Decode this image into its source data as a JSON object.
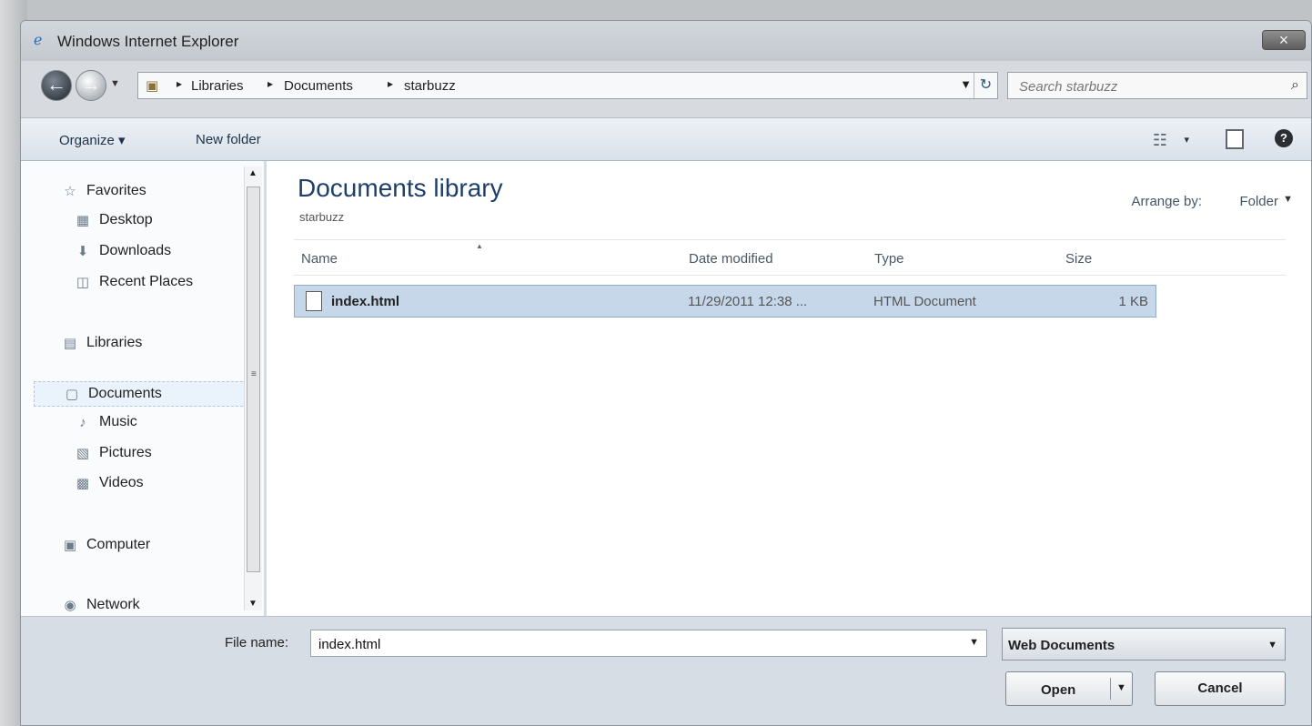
{
  "window": {
    "title": "Windows Internet Explorer",
    "close_symbol": "×"
  },
  "nav": {
    "back_icon": "back-arrow-icon",
    "forward_icon": "forward-arrow-icon",
    "recent_dropdown": "▼"
  },
  "address": {
    "breadcrumbs": [
      "Libraries",
      "Documents",
      "starbuzz"
    ],
    "separator": "▸",
    "dropdown_symbol": "▼",
    "refresh_symbol": "↻"
  },
  "search": {
    "placeholder": "Search starbuzz",
    "value": ""
  },
  "toolbar": {
    "organize_label": "Organize ▾",
    "new_folder_label": "New folder",
    "view_dropdown": "▾"
  },
  "sidebar": {
    "items": [
      {
        "label": "Favorites",
        "icon": "star-icon"
      },
      {
        "label": "Desktop",
        "icon": "desktop-icon"
      },
      {
        "label": "Downloads",
        "icon": "downloads-icon"
      },
      {
        "label": "Recent Places",
        "icon": "recent-places-icon"
      },
      {
        "label": "Libraries",
        "icon": "libraries-icon"
      },
      {
        "label": "Documents",
        "icon": "documents-icon",
        "selected": true
      },
      {
        "label": "Music",
        "icon": "music-icon"
      },
      {
        "label": "Pictures",
        "icon": "pictures-icon"
      },
      {
        "label": "Videos",
        "icon": "videos-icon"
      },
      {
        "label": "Computer",
        "icon": "computer-icon"
      },
      {
        "label": "Network",
        "icon": "network-icon"
      }
    ]
  },
  "main": {
    "library_title": "Documents library",
    "library_sub": "starbuzz",
    "arrange_label": "Arrange by:",
    "arrange_value": "Folder",
    "arrange_symbol": "▼",
    "columns": [
      "Name",
      "Date modified",
      "Type",
      "Size"
    ],
    "sort_symbol": "▲",
    "files": [
      {
        "name": "index.html",
        "date": "11/29/2011 12:38 ...",
        "type": "HTML Document",
        "size": "1 KB",
        "selected": true
      }
    ]
  },
  "bottom": {
    "filename_label": "File name:",
    "filename_value": "index.html",
    "dropdown_symbol": "▼",
    "file_type": "Web Documents",
    "open_label": "Open",
    "cancel_label": "Cancel"
  },
  "colors": {
    "toolbar": "#dfe7f0",
    "selection": "#c7d7ea",
    "title_blue": "#1f3f6b"
  }
}
